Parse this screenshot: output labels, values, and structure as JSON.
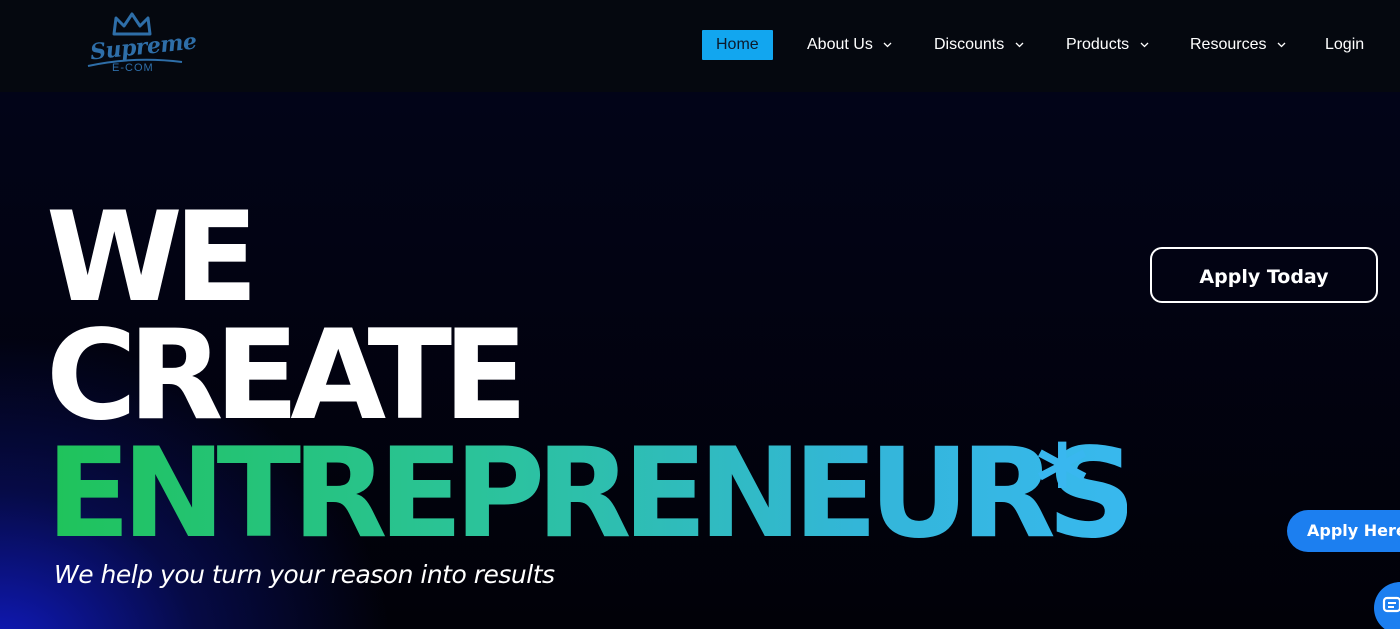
{
  "brand": {
    "logo_word": "Supreme",
    "logo_sub": "E-COM",
    "logo_color": "#2e6ea8"
  },
  "nav": {
    "items": [
      {
        "label": "Home",
        "active": true
      },
      {
        "label": "About Us",
        "dropdown": true
      },
      {
        "label": "Discounts",
        "dropdown": true
      },
      {
        "label": "Products",
        "dropdown": true
      },
      {
        "label": "Resources",
        "dropdown": true
      },
      {
        "label": "Login"
      }
    ],
    "active_color": "#12a6ef"
  },
  "hero": {
    "line1": "WE",
    "line2": "CREATE",
    "line3": "ENTREPRENEURS",
    "asterisk": "*",
    "tagline": "We help you turn your reason into results",
    "gradient_start": "#1fc35a",
    "gradient_end": "#38b8ee"
  },
  "cta": {
    "apply_today": "Apply Today",
    "apply_here": "Apply Here",
    "accent": "#1c7ff0"
  },
  "icons": {
    "logo": "crown-icon",
    "dropdown": "chevron-down-icon",
    "chat": "chat-icon"
  }
}
